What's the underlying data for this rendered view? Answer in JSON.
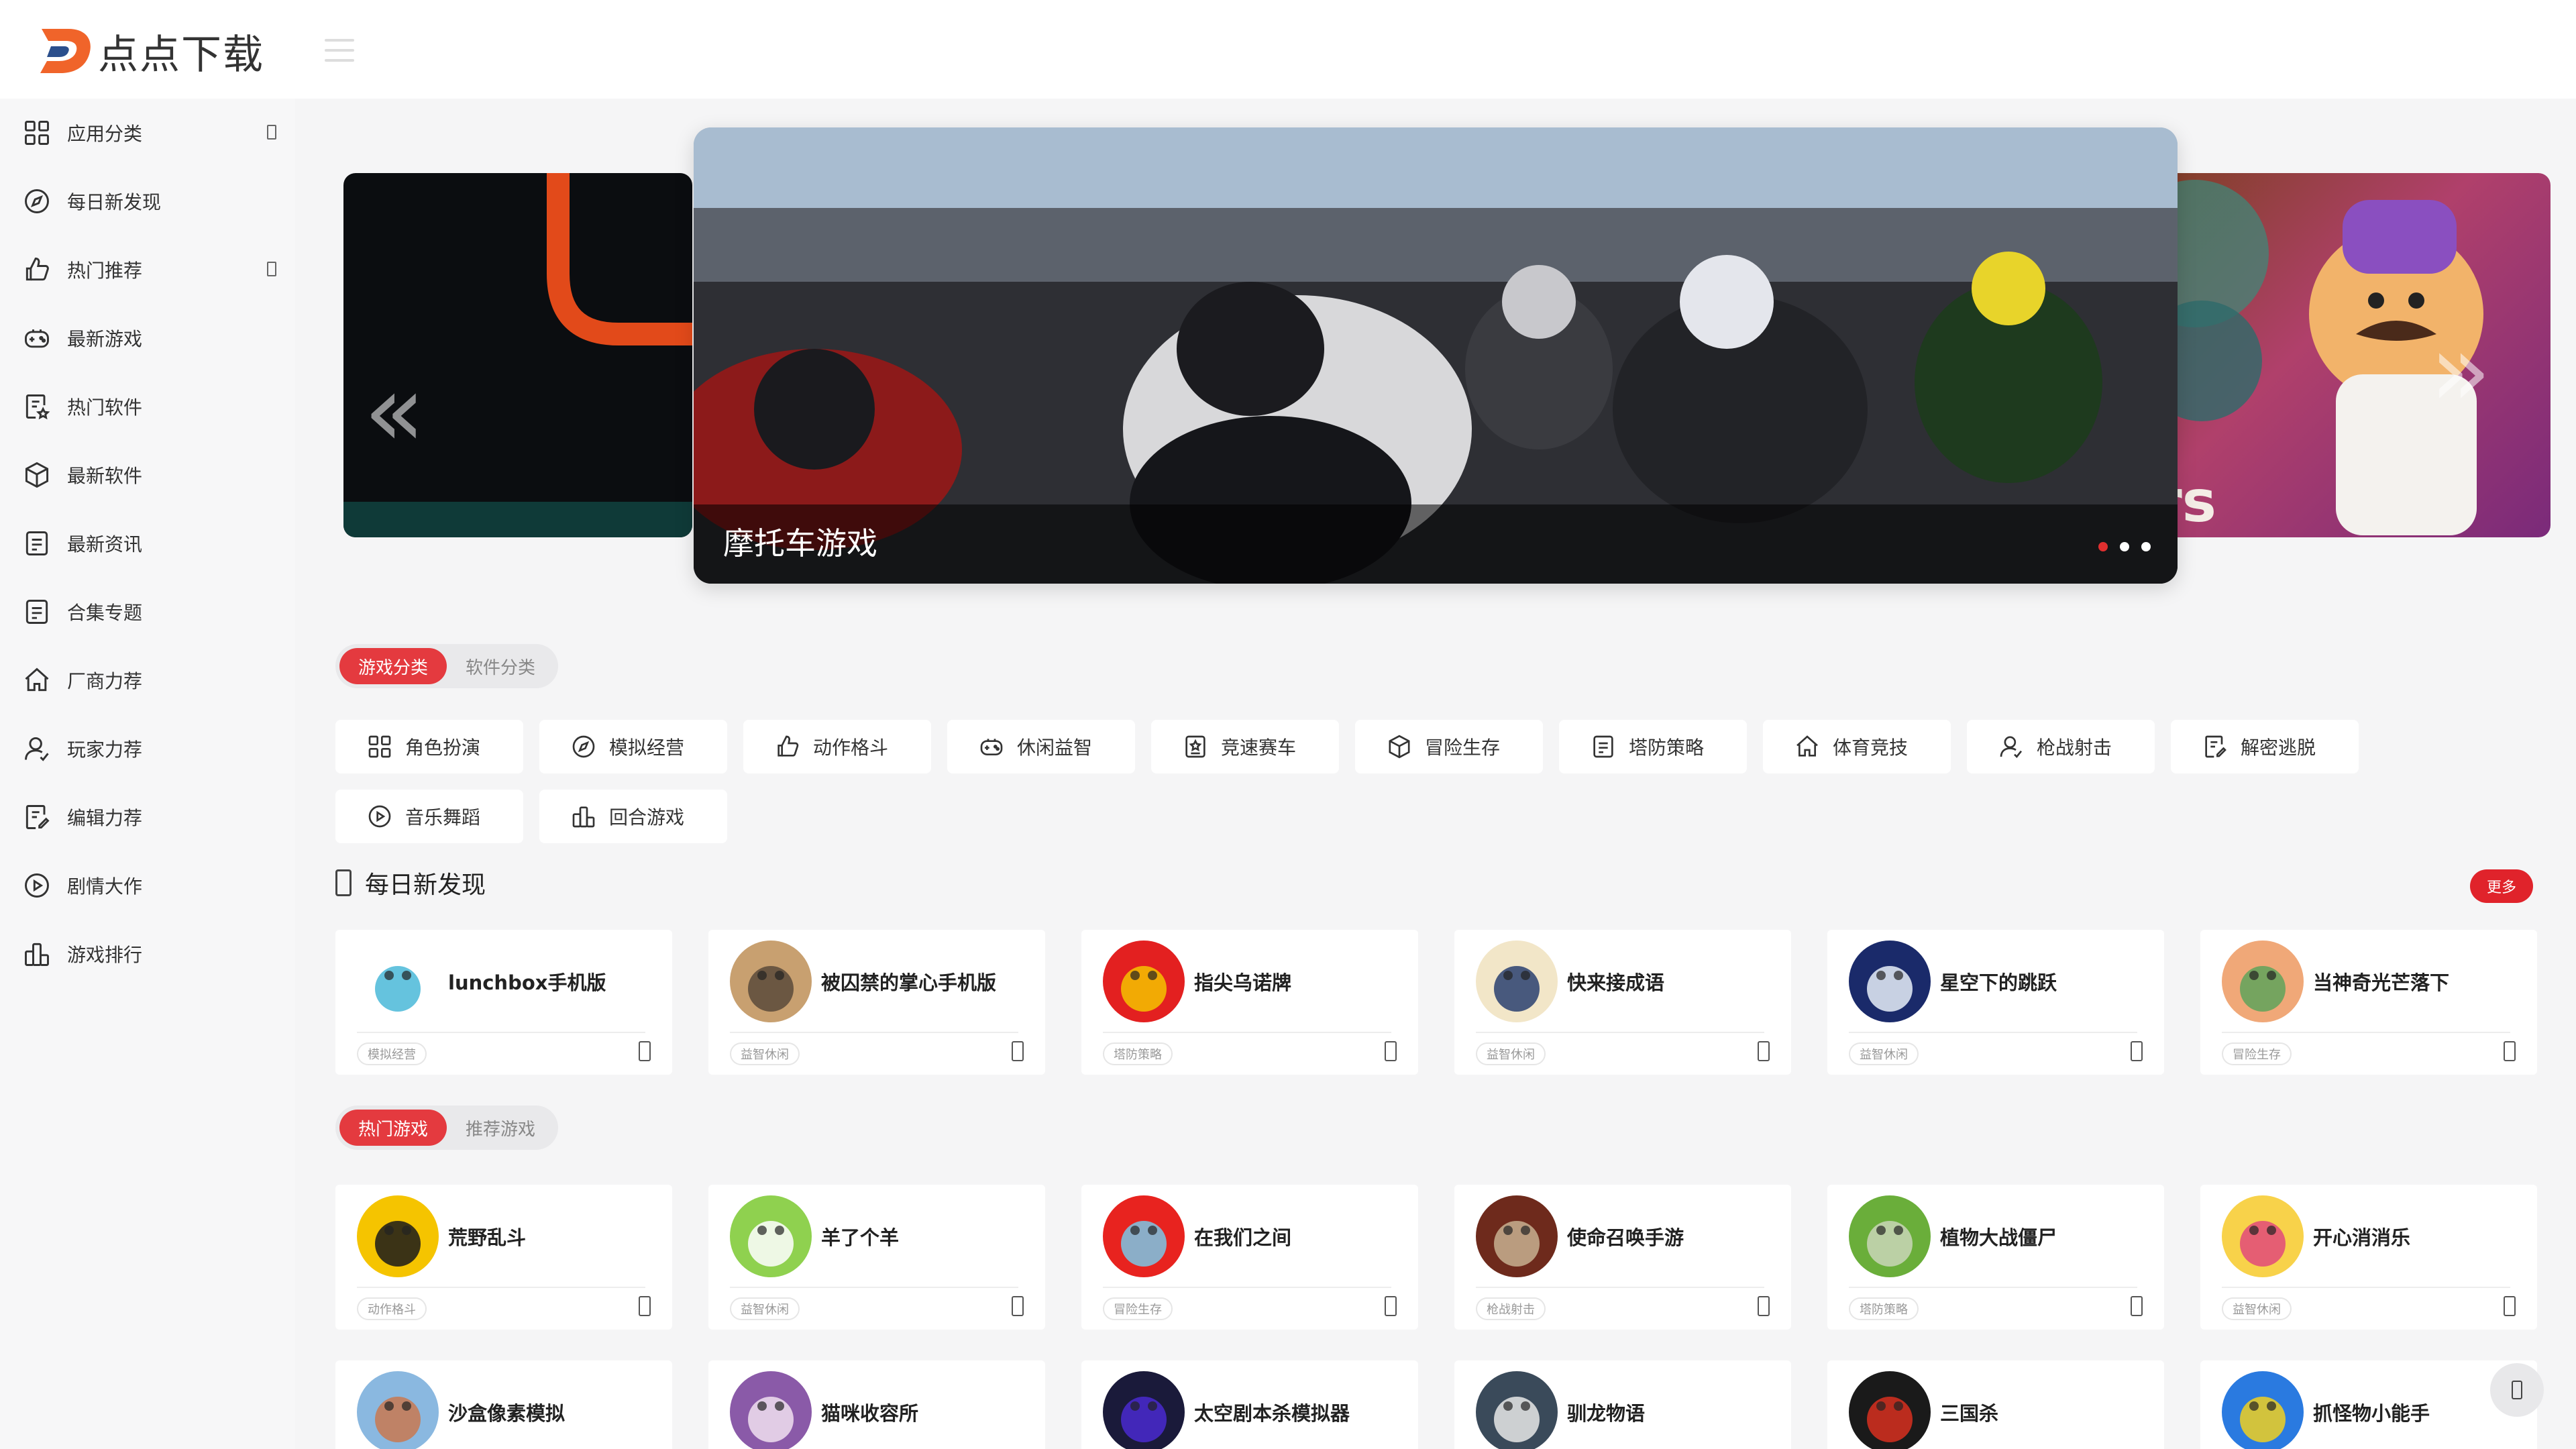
{
  "brand": {
    "name": "点点下载",
    "accent": "#e43a3f"
  },
  "sidebar": {
    "items": [
      {
        "label": "应用分类",
        "icon": "grid-icon",
        "has_caret": true
      },
      {
        "label": "每日新发现",
        "icon": "compass-icon",
        "has_caret": false
      },
      {
        "label": "热门推荐",
        "icon": "thumbs-up-icon",
        "has_caret": true
      },
      {
        "label": "最新游戏",
        "icon": "gamepad-icon",
        "has_caret": false
      },
      {
        "label": "热门软件",
        "icon": "doc-star-icon",
        "has_caret": false
      },
      {
        "label": "最新软件",
        "icon": "cube-icon",
        "has_caret": false
      },
      {
        "label": "最新资讯",
        "icon": "document-icon",
        "has_caret": false
      },
      {
        "label": "合集专题",
        "icon": "document-icon",
        "has_caret": false
      },
      {
        "label": "厂商力荐",
        "icon": "home-icon",
        "has_caret": false
      },
      {
        "label": "玩家力荐",
        "icon": "user-icon",
        "has_caret": false
      },
      {
        "label": "编辑力荐",
        "icon": "doc-edit-icon",
        "has_caret": false
      },
      {
        "label": "剧情大作",
        "icon": "play-circle-icon",
        "has_caret": false
      },
      {
        "label": "游戏排行",
        "icon": "ranking-icon",
        "has_caret": false
      }
    ]
  },
  "banner": {
    "caption": "摩托车游戏",
    "prev_glyph": "«",
    "next_glyph": "»",
    "right_slide_text": "ers",
    "dots": 3,
    "active_dot": 0
  },
  "category_tabs": {
    "tabs": [
      "游戏分类",
      "软件分类"
    ],
    "active": 0
  },
  "categories": [
    {
      "label": "角色扮演",
      "icon": "grid-icon"
    },
    {
      "label": "模拟经营",
      "icon": "compass-icon"
    },
    {
      "label": "动作格斗",
      "icon": "thumbs-up-icon"
    },
    {
      "label": "休闲益智",
      "icon": "gamepad-icon"
    },
    {
      "label": "竞速赛车",
      "icon": "badge-icon"
    },
    {
      "label": "冒险生存",
      "icon": "cube-icon"
    },
    {
      "label": "塔防策略",
      "icon": "document-icon"
    },
    {
      "label": "体育竞技",
      "icon": "home-icon"
    },
    {
      "label": "枪战射击",
      "icon": "user-icon"
    },
    {
      "label": "解密逃脱",
      "icon": "doc-edit-icon"
    },
    {
      "label": "音乐舞蹈",
      "icon": "play-circle-icon"
    },
    {
      "label": "回合游戏",
      "icon": "ranking-icon"
    }
  ],
  "daily": {
    "title": "每日新发现",
    "more": "更多",
    "apps": [
      {
        "name": "lunchbox手机版",
        "tag": "模拟经营",
        "color": "#ffffff",
        "color2": "#4ab8d8"
      },
      {
        "name": "被囚禁的掌心手机版",
        "tag": "益智休闲",
        "color": "#c8a070",
        "color2": "#5a4a3a"
      },
      {
        "name": "指尖乌诺牌",
        "tag": "塔防策略",
        "color": "#e32020",
        "color2": "#f4c300"
      },
      {
        "name": "快来接成语",
        "tag": "益智休闲",
        "color": "#f2e6c8",
        "color2": "#2a4070"
      },
      {
        "name": "星空下的跳跃",
        "tag": "益智休闲",
        "color": "#1a2a6a",
        "color2": "#e8eef8"
      },
      {
        "name": "当神奇光芒落下",
        "tag": "冒险生存",
        "color": "#f0a878",
        "color2": "#5fa35a"
      }
    ]
  },
  "hot_tabs": {
    "tabs": [
      "热门游戏",
      "推荐游戏"
    ],
    "active": 0
  },
  "hot_games": [
    {
      "name": "荒野乱斗",
      "tag": "动作格斗",
      "color": "#f5c400",
      "color2": "#1a1a1a"
    },
    {
      "name": "羊了个羊",
      "tag": "益智休闲",
      "color": "#8fd14f",
      "color2": "#ffffff"
    },
    {
      "name": "在我们之间",
      "tag": "冒险生存",
      "color": "#e8231f",
      "color2": "#7ac7e6"
    },
    {
      "name": "使命召唤手游",
      "tag": "枪战射击",
      "color": "#6e2a1c",
      "color2": "#c8b090"
    },
    {
      "name": "植物大战僵尸",
      "tag": "塔防策略",
      "color": "#6aae3a",
      "color2": "#c9d6b8"
    },
    {
      "name": "开心消消乐",
      "tag": "益智休闲",
      "color": "#f8d24a",
      "color2": "#e24a7a"
    }
  ],
  "more_games": [
    {
      "name": "沙盒像素模拟",
      "color": "#8ab8e0",
      "color2": "#c87850"
    },
    {
      "name": "猫咪收容所",
      "color": "#8a5aa8",
      "color2": "#f0e0f0"
    },
    {
      "name": "太空剧本杀模拟器",
      "color": "#1a1a3a",
      "color2": "#4a2ad0"
    },
    {
      "name": "驯龙物语",
      "color": "#3a4a5a",
      "color2": "#e8e8e8"
    },
    {
      "name": "三国杀",
      "color": "#1a1a1a",
      "color2": "#d83020"
    },
    {
      "name": "抓怪物小能手",
      "color": "#2a7ae0",
      "color2": "#f0d020"
    }
  ]
}
